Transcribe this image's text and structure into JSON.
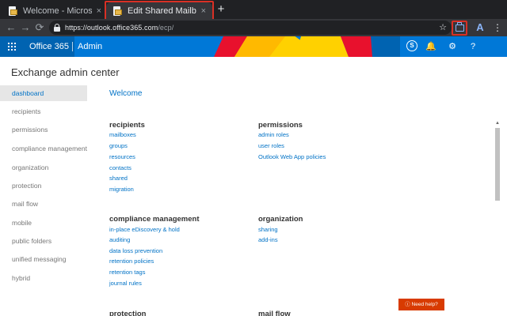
{
  "browser": {
    "tabs": [
      {
        "title": "Welcome - Microsoft Exch",
        "close": "×"
      },
      {
        "title": "Edit Shared Mailbox",
        "close": "×"
      }
    ],
    "new_tab": "+",
    "url_host": "https://outlook.office365.com",
    "url_path": "/ecp/",
    "star": "☆",
    "kebab": "⋮",
    "profile": "A",
    "highlight_color": "#d93025"
  },
  "o365": {
    "brand": "Office 365",
    "app": "Admin",
    "bg_color": "#0078d7"
  },
  "eac": {
    "title": "Exchange admin center",
    "nav": [
      "dashboard",
      "recipients",
      "permissions",
      "compliance management",
      "organization",
      "protection",
      "mail flow",
      "mobile",
      "public folders",
      "unified messaging",
      "hybrid"
    ],
    "active_nav": "dashboard",
    "welcome": "Welcome",
    "sections": [
      {
        "head": "recipients",
        "links": [
          "mailboxes",
          "groups",
          "resources",
          "contacts",
          "shared",
          "migration"
        ]
      },
      {
        "head": "permissions",
        "links": [
          "admin roles",
          "user roles",
          "Outlook Web App policies"
        ]
      },
      {
        "head": "compliance management",
        "links": [
          "in-place eDiscovery & hold",
          "auditing",
          "data loss prevention",
          "retention policies",
          "retention tags",
          "journal rules"
        ]
      },
      {
        "head": "organization",
        "links": [
          "sharing",
          "add-ins"
        ]
      }
    ],
    "cut_off": [
      "protection",
      "mail flow"
    ],
    "help": "Need help?",
    "link_color": "#0072c6",
    "help_color": "#d83b01"
  }
}
